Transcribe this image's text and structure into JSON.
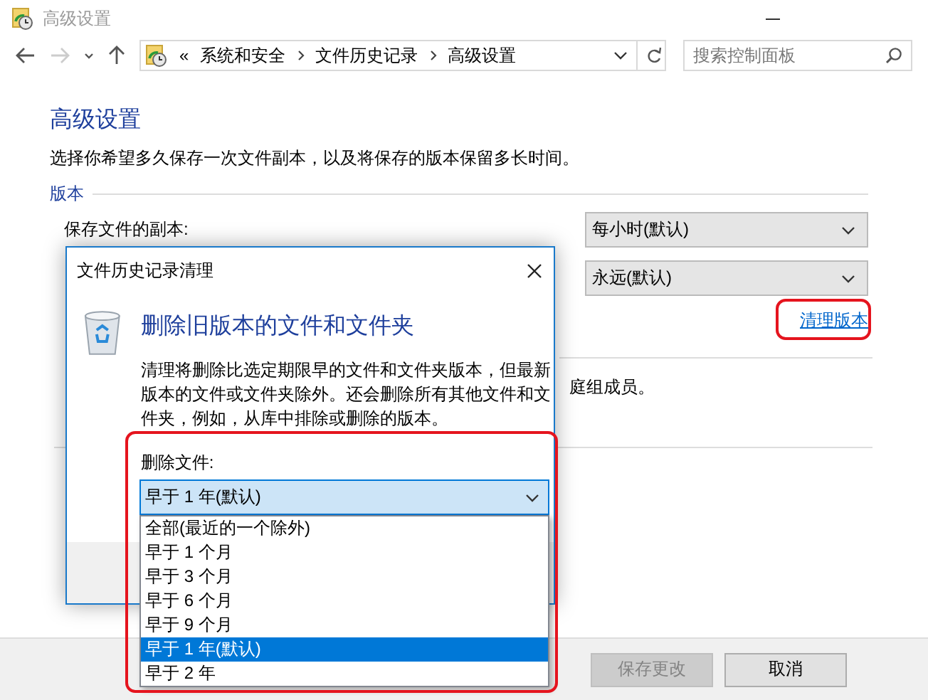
{
  "window": {
    "title": "高级设置"
  },
  "address_bar": {
    "prefix": "«",
    "segments": [
      "系统和安全",
      "文件历史记录",
      "高级设置"
    ]
  },
  "search": {
    "placeholder": "搜索控制面板"
  },
  "page": {
    "heading": "高级设置",
    "description": "选择你希望多久保存一次文件副本，以及将保存的版本保留多长时间。"
  },
  "versions": {
    "label": "版本",
    "copy_label": "保存文件的副本:",
    "selects": [
      "每小时(默认)",
      "永远(默认)"
    ],
    "cleanup_link": "清理版本"
  },
  "section_2": {
    "text": "庭组成员。"
  },
  "buttons": [
    {
      "label": "保存更改",
      "disabled": true
    },
    {
      "label": "取消",
      "disabled": false
    }
  ],
  "dialog": {
    "title": "文件历史记录清理",
    "heading": "删除旧版本的文件和文件夹",
    "description": "清理将删除比选定期限早的文件和文件夹版本，但最新版本的文件或文件夹除外。还会删除所有其他文件和文件夹，例如，从库中排除或删除的版本。",
    "field_label": "删除文件:",
    "select": {
      "value": "早于 1 年(默认)",
      "expanded": true
    },
    "options": [
      {
        "label": "全部(最近的一个除外)",
        "selected": false
      },
      {
        "label": "早于 1 个月",
        "selected": false
      },
      {
        "label": "早于 3 个月",
        "selected": false
      },
      {
        "label": "早于 6 个月",
        "selected": false
      },
      {
        "label": "早于 9 个月",
        "selected": false
      },
      {
        "label": "早于 1 年(默认)",
        "selected": true
      },
      {
        "label": "早于 2 年",
        "selected": false
      }
    ]
  }
}
